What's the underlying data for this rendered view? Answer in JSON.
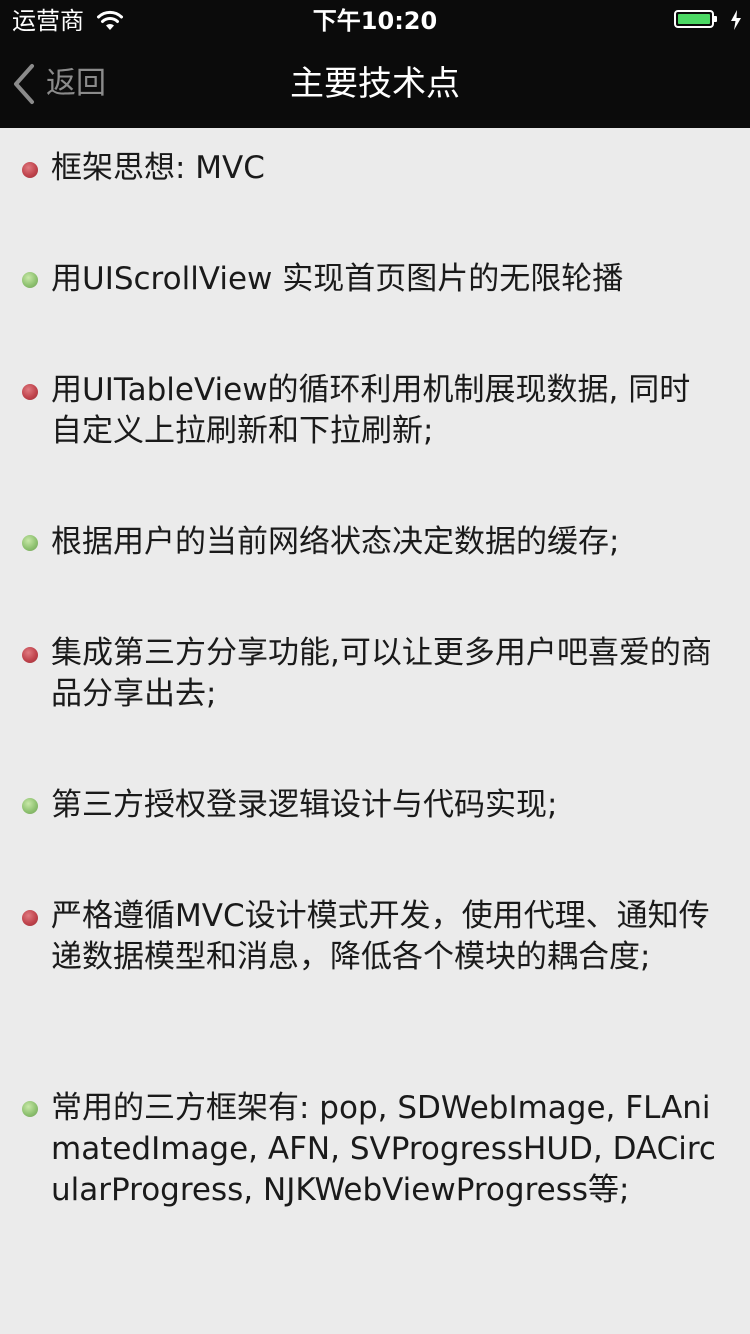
{
  "status_bar": {
    "carrier": "运营商",
    "time": "下午10:20",
    "battery_color": "#4cd964"
  },
  "nav": {
    "back_label": "返回",
    "title": "主要技术点"
  },
  "points": [
    {
      "text": "框架思想: MVC",
      "bullet": "red"
    },
    {
      "text": "用UIScrollView 实现首页图片的无限轮播",
      "bullet": "green"
    },
    {
      "text": "用UITableView的循环利用机制展现数据, 同时自定义上拉刷新和下拉刷新;",
      "bullet": "red"
    },
    {
      "text": "根据用户的当前网络状态决定数据的缓存;",
      "bullet": "green"
    },
    {
      "text": "集成第三方分享功能,可以让更多用户吧喜爱的商品分享出去;",
      "bullet": "red"
    },
    {
      "text": "第三方授权登录逻辑设计与代码实现;",
      "bullet": "green"
    },
    {
      "text": "严格遵循MVC设计模式开发，使用代理、通知传递数据模型和消息，降低各个模块的耦合度;",
      "bullet": "red"
    },
    {
      "text": "常用的三方框架有: pop, SDWebImage, FLAnimatedImage, AFN, SVProgressHUD, DACircularProgress, NJKWebViewProgress等;",
      "bullet": "green"
    }
  ],
  "colors": {
    "bullet_red": "#c0444d",
    "bullet_green": "#8fc271",
    "background": "#ebebeb",
    "nav_background": "#0b0b0b"
  }
}
